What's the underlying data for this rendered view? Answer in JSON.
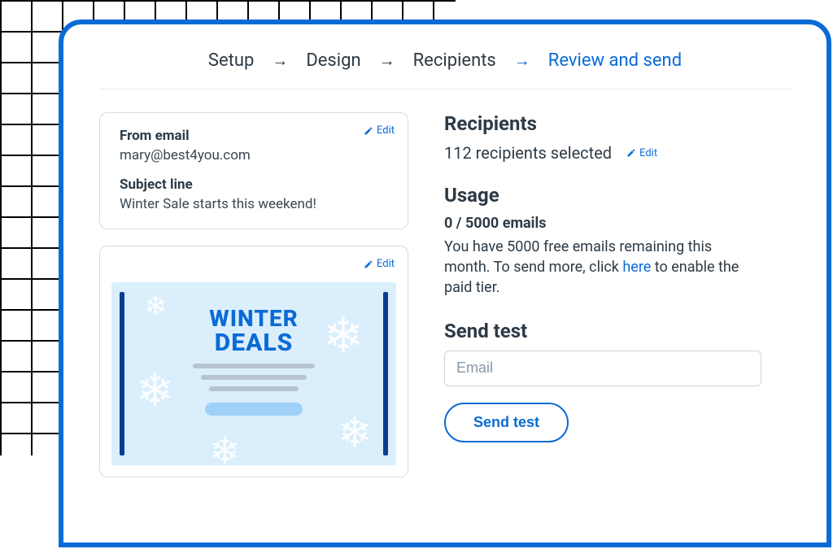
{
  "steps": {
    "items": [
      "Setup",
      "Design",
      "Recipients",
      "Review and send"
    ],
    "active_index": 3
  },
  "edit_label": "Edit",
  "setup_panel": {
    "from_label": "From email",
    "from_value": "mary@best4you.com",
    "subject_label": "Subject line",
    "subject_value": "Winter Sale starts this weekend!"
  },
  "preview": {
    "headline1": "WINTER",
    "headline2": "DEALS"
  },
  "recipients": {
    "heading": "Recipients",
    "summary": "112 recipients selected"
  },
  "usage": {
    "heading": "Usage",
    "count_text": "0 / 5000 emails",
    "body_pre": "You have 5000 free emails remaining this month. To send more, click ",
    "link_text": "here",
    "body_post": " to enable the paid tier."
  },
  "send_test": {
    "heading": "Send test",
    "placeholder": "Email",
    "button": "Send test"
  }
}
